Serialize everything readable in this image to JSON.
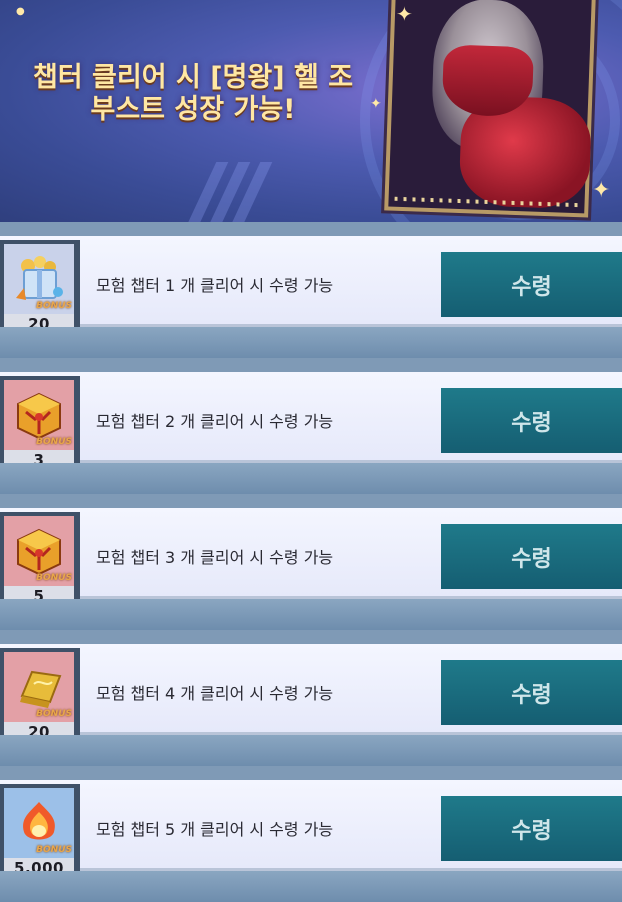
{
  "banner": {
    "headline_line1": "챕터 클리어 시 [명왕] 헬 조",
    "headline_line2": "부스트 성장 가능!"
  },
  "missions": [
    {
      "description": "모험 챕터 1 개 클리어 시 수령 가능",
      "reward_qty": "20",
      "bonus_label": "BONUS",
      "reward_icon": "blue-gift-box-icon",
      "thumb_color": "#c9d2ea",
      "claim_label": "수령"
    },
    {
      "description": "모험 챕터 2 개 클리어 시 수령 가능",
      "reward_qty": "3",
      "bonus_label": "BONUS",
      "reward_icon": "gold-cube-icon",
      "thumb_color": "#e3a0a6",
      "claim_label": "수령"
    },
    {
      "description": "모험 챕터 3 개 클리어 시 수령 가능",
      "reward_qty": "5",
      "bonus_label": "BONUS",
      "reward_icon": "gold-cube-icon",
      "thumb_color": "#e3a0a6",
      "claim_label": "수령"
    },
    {
      "description": "모험 챕터 4 개 클리어 시 수령 가능",
      "reward_qty": "20",
      "bonus_label": "BONUS",
      "reward_icon": "gold-bar-icon",
      "thumb_color": "#e3a0a6",
      "claim_label": "수령"
    },
    {
      "description": "모험 챕터 5 개 클리어 시 수령 가능",
      "reward_qty": "5,000",
      "bonus_label": "BONUS",
      "reward_icon": "fire-gem-icon",
      "thumb_color": "#9cc0e8",
      "claim_label": "수령"
    }
  ],
  "colors": {
    "claim_button": "#1a6d7e",
    "headline": "#ffe7a3"
  }
}
